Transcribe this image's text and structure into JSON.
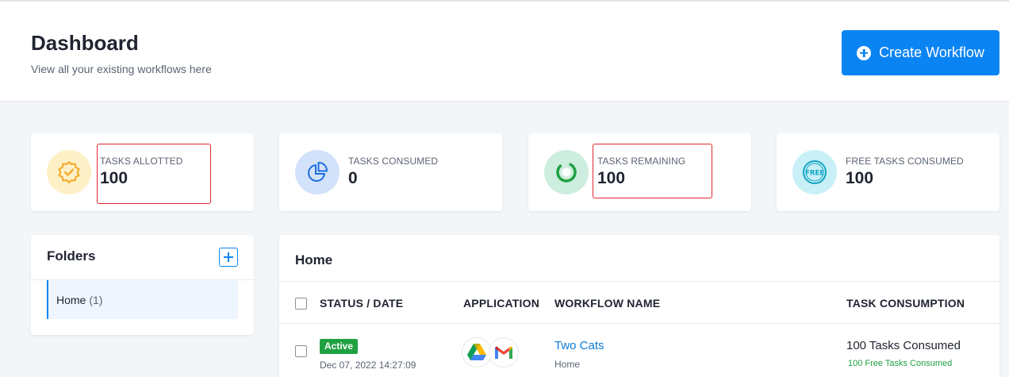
{
  "header": {
    "title": "Dashboard",
    "subtitle": "View all your existing workflows here",
    "create_button_label": "Create Workflow"
  },
  "stats": [
    {
      "label": "TASKS ALLOTTED",
      "value": "100",
      "icon": "verified-badge-icon",
      "highlighted": true
    },
    {
      "label": "TASKS CONSUMED",
      "value": "0",
      "icon": "pie-chart-icon",
      "highlighted": false
    },
    {
      "label": "TASKS REMAINING",
      "value": "100",
      "icon": "ring-chart-icon",
      "highlighted": true
    },
    {
      "label": "FREE TASKS CONSUMED",
      "value": "100",
      "icon": "free-stamp-icon",
      "icon_text": "FREE",
      "highlighted": false
    }
  ],
  "colors": {
    "accent": "#0b84f3",
    "highlight": "#e0262f",
    "active": "#1fa142",
    "link": "#0b7bd6"
  },
  "folders": {
    "title": "Folders",
    "items": [
      {
        "name": "Home",
        "count": "(1)"
      }
    ]
  },
  "workflows": {
    "title": "Home",
    "columns": [
      "STATUS / DATE",
      "APPLICATION",
      "WORKFLOW NAME",
      "TASK CONSUMPTION"
    ],
    "rows": [
      {
        "status": "Active",
        "date": "Dec 07, 2022 14:27:09",
        "apps": [
          "google-drive-icon",
          "gmail-icon"
        ],
        "name": "Two Cats",
        "folder": "Home",
        "consumption": "100 Tasks Consumed",
        "free_consumption": "100 Free Tasks Consumed"
      }
    ]
  }
}
